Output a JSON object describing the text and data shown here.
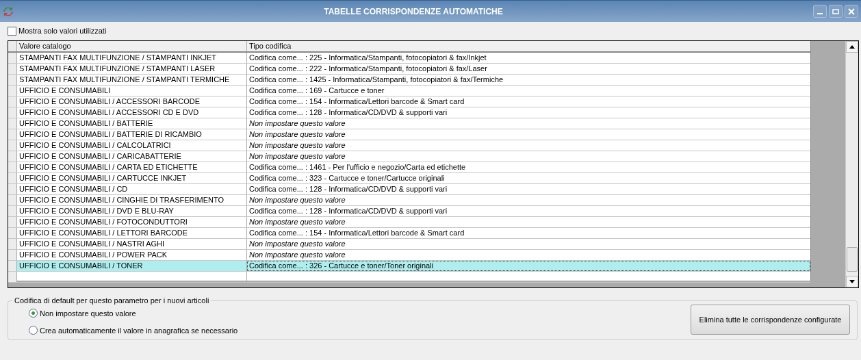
{
  "window": {
    "title": "TABELLE CORRISPONDENZE AUTOMATICHE"
  },
  "filter": {
    "label": "Mostra solo valori utilizzati",
    "checked": false
  },
  "table": {
    "columns": [
      "Valore catalogo",
      "Tipo codifica"
    ],
    "rows": [
      {
        "value": "STAMPANTI FAX MULTIFUNZIONE / STAMPANTI INKJET",
        "code": "Codifica come... : 225 - Informatica/Stampanti, fotocopiatori & fax/Inkjet",
        "kind": "mapped",
        "selected": false
      },
      {
        "value": "STAMPANTI FAX MULTIFUNZIONE / STAMPANTI LASER",
        "code": "Codifica come... : 222 - Informatica/Stampanti, fotocopiatori & fax/Laser",
        "kind": "mapped",
        "selected": false
      },
      {
        "value": "STAMPANTI FAX MULTIFUNZIONE / STAMPANTI TERMICHE",
        "code": "Codifica come... : 1425 - Informatica/Stampanti, fotocopiatori & fax/Termiche",
        "kind": "mapped",
        "selected": false
      },
      {
        "value": "UFFICIO E CONSUMABILI",
        "code": "Codifica come... : 169 - Cartucce e toner",
        "kind": "mapped",
        "selected": false
      },
      {
        "value": "UFFICIO E CONSUMABILI / ACCESSORI BARCODE",
        "code": "Codifica come... : 154 - Informatica/Lettori barcode & Smart card",
        "kind": "mapped",
        "selected": false
      },
      {
        "value": "UFFICIO E CONSUMABILI / ACCESSORI CD E DVD",
        "code": "Codifica come... : 128 - Informatica/CD/DVD & supporti vari",
        "kind": "mapped",
        "selected": false
      },
      {
        "value": "UFFICIO E CONSUMABILI / BATTERIE",
        "code": "Non impostare questo valore",
        "kind": "unset",
        "selected": false
      },
      {
        "value": "UFFICIO E CONSUMABILI / BATTERIE DI RICAMBIO",
        "code": "Non impostare questo valore",
        "kind": "unset",
        "selected": false
      },
      {
        "value": "UFFICIO E CONSUMABILI / CALCOLATRICI",
        "code": "Non impostare questo valore",
        "kind": "unset",
        "selected": false
      },
      {
        "value": "UFFICIO E CONSUMABILI / CARICABATTERIE",
        "code": "Non impostare questo valore",
        "kind": "unset",
        "selected": false
      },
      {
        "value": "UFFICIO E CONSUMABILI / CARTA ED ETICHETTE",
        "code": "Codifica come... : 1461 - Per l'ufficio e negozio/Carta ed etichette",
        "kind": "mapped",
        "selected": false
      },
      {
        "value": "UFFICIO E CONSUMABILI / CARTUCCE INKJET",
        "code": "Codifica come... : 323 - Cartucce e toner/Cartucce originali",
        "kind": "mapped",
        "selected": false
      },
      {
        "value": "UFFICIO E CONSUMABILI / CD",
        "code": "Codifica come... : 128 - Informatica/CD/DVD & supporti vari",
        "kind": "mapped",
        "selected": false
      },
      {
        "value": "UFFICIO E CONSUMABILI / CINGHIE DI TRASFERIMENTO",
        "code": "Non impostare questo valore",
        "kind": "unset",
        "selected": false
      },
      {
        "value": "UFFICIO E CONSUMABILI / DVD E BLU-RAY",
        "code": "Codifica come... : 128 - Informatica/CD/DVD & supporti vari",
        "kind": "mapped",
        "selected": false
      },
      {
        "value": "UFFICIO E CONSUMABILI / FOTOCONDUTTORI",
        "code": "Non impostare questo valore",
        "kind": "unset",
        "selected": false
      },
      {
        "value": "UFFICIO E CONSUMABILI / LETTORI BARCODE",
        "code": "Codifica come... : 154 - Informatica/Lettori barcode & Smart card",
        "kind": "mapped",
        "selected": false
      },
      {
        "value": "UFFICIO E CONSUMABILI / NASTRI AGHI",
        "code": "Non impostare questo valore",
        "kind": "unset",
        "selected": false
      },
      {
        "value": "UFFICIO E CONSUMABILI / POWER PACK",
        "code": "Non impostare questo valore",
        "kind": "unset",
        "selected": false
      },
      {
        "value": "UFFICIO E CONSUMABILI / TONER",
        "code": "Codifica come... : 326 - Cartucce e toner/Toner originali",
        "kind": "mapped",
        "selected": true
      }
    ]
  },
  "default_group": {
    "title": "Codifica di default per questo parametro per i nuovi articoli",
    "options": [
      {
        "label": "Non impostare questo valore",
        "selected": true
      },
      {
        "label": "Crea automaticamente il valore in anagrafica se necessario",
        "selected": false
      }
    ],
    "button": "Elimina tutte le corrispondenze configurate"
  }
}
